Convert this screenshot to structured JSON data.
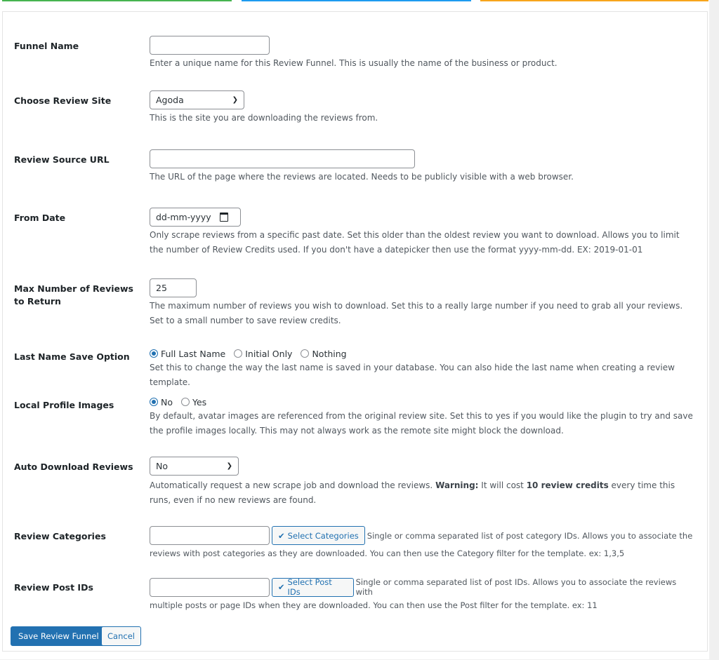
{
  "colors": {
    "accent_green": "#46b450",
    "accent_blue": "#1e9bf0",
    "accent_orange": "#f7a51c",
    "primary": "#2271b1"
  },
  "form": {
    "funnel_name": {
      "label": "Funnel Name",
      "value": "",
      "desc": "Enter a unique name for this Review Funnel. This is usually the name of the business or product."
    },
    "review_site": {
      "label": "Choose Review Site",
      "value": "Agoda",
      "desc": "This is the site you are downloading the reviews from."
    },
    "source_url": {
      "label": "Review Source URL",
      "value": "",
      "desc": "The URL of the page where the reviews are located. Needs to be publicly visible with a web browser."
    },
    "from_date": {
      "label": "From Date",
      "placeholder": "dd-mm-yyyy",
      "desc": "Only scrape reviews from a specific past date. Set this older than the oldest review you want to download. Allows you to limit the number of Review Credits used. If you don't have a datepicker then use the format yyyy-mm-dd. EX: 2019-01-01"
    },
    "max_reviews": {
      "label": "Max Number of Reviews to Return",
      "value": "25",
      "desc": "The maximum number of reviews you wish to download. Set this to a really large number if you need to grab all your reviews. Set to a small number to save review credits."
    },
    "last_name": {
      "label": "Last Name Save Option",
      "options": [
        "Full Last Name",
        "Initial Only",
        "Nothing"
      ],
      "selected": "Full Last Name",
      "desc": "Set this to change the way the last name is saved in your database. You can also hide the last name when creating a review template."
    },
    "local_images": {
      "label": "Local Profile Images",
      "options": [
        "No",
        "Yes"
      ],
      "selected": "No",
      "desc": "By default, avatar images are referenced from the original review site. Set this to yes if you would like the plugin to try and save the profile images locally. This may not always work as the remote site might block the download."
    },
    "auto_download": {
      "label": "Auto Download Reviews",
      "value": "No",
      "desc_pre": "Automatically request a new scrape job and download the reviews. ",
      "desc_warn": "Warning:",
      "desc_mid": " It will cost ",
      "desc_credits": "10 review credits",
      "desc_post": " every time this runs, even if no new reviews are found."
    },
    "categories": {
      "label": "Review Categories",
      "value": "",
      "button": "Select Categories",
      "desc_inline": "Single or comma separated list of post category IDs. Allows you to associate the",
      "desc_rest": "reviews with post categories as they are downloaded. You can then use the Category filter for the template. ex: 1,3,5"
    },
    "post_ids": {
      "label": "Review Post IDs",
      "value": "",
      "button": "Select Post IDs",
      "desc_inline": "Single or comma separated list of post IDs. Allows you to associate the reviews with",
      "desc_rest": "multiple posts or page IDs when they are downloaded. You can then use the Post filter for the template. ex: 11"
    }
  },
  "actions": {
    "save": "Save Review Funnel",
    "cancel": "Cancel"
  }
}
